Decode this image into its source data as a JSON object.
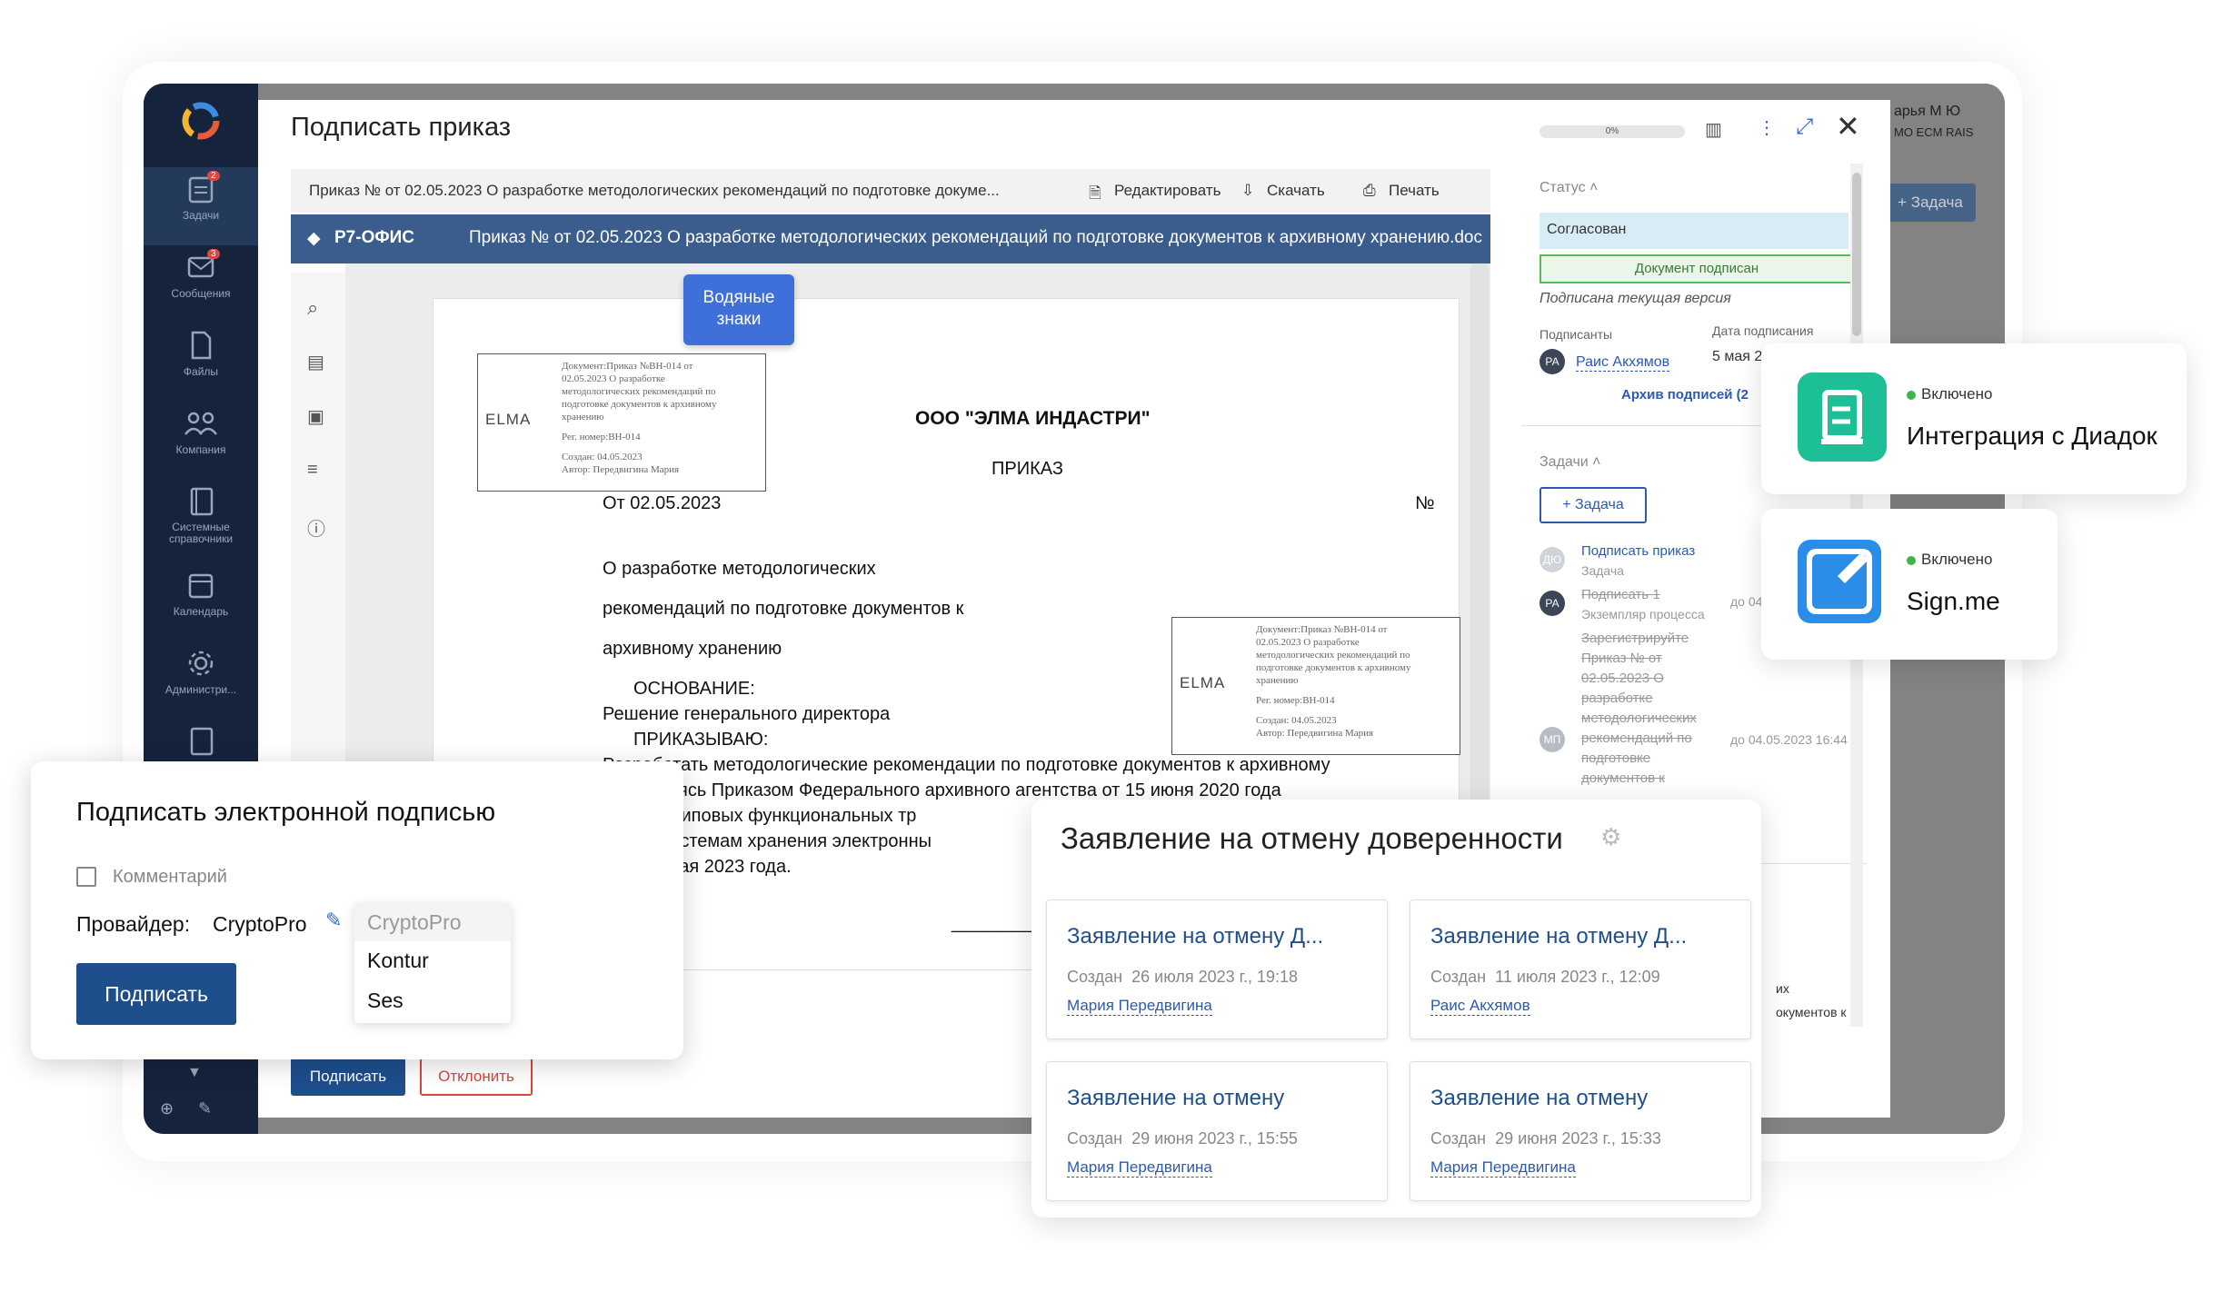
{
  "sidebar": {
    "items": [
      {
        "label": "Задачи",
        "badge": "2"
      },
      {
        "label": "Сообщения",
        "badge": "3"
      },
      {
        "label": "Файлы"
      },
      {
        "label": "Компания"
      },
      {
        "label": "Системные справочники"
      },
      {
        "label": "Календарь"
      },
      {
        "label": "Администри..."
      }
    ]
  },
  "topbar": {
    "user": "арья М Ю",
    "org": "МО ECM RAIS",
    "task_button": "+ Задача"
  },
  "modal": {
    "title": "Подписать приказ",
    "progress_label": "0%",
    "document_title": "Приказ № от 02.05.2023 О разработке методологических рекомендаций по подготовке докуме...",
    "actions": {
      "edit": "Редактировать",
      "download": "Скачать",
      "print": "Печать"
    },
    "editor_name": "Р7-ОФИС",
    "editor_doc_title": "Приказ № от 02.05.2023 О разработке методологических рекомендаций по подготовке документов к архивному хранению.doc",
    "watermark_tooltip": [
      "Водяные",
      "знаки"
    ],
    "sign_button": "Подписать",
    "reject_button": "Отклонить"
  },
  "document": {
    "company": "ООО \"ЭЛМА ИНДАСТРИ\"",
    "doc_type": "ПРИКАЗ",
    "date_line": "От 02.05.2023",
    "number_sign": "№",
    "subject": [
      "О разработке методологических",
      "рекомендаций по подготовке документов к",
      "архивному хранению"
    ],
    "basis_heading": "ОСНОВАНИЕ:",
    "basis_text": "Решение генерального директора",
    "order_heading": "ПРИКАЗЫВАЮ:",
    "body_lines": [
      "Разработать методологические рекомендации по подготовке документов к архивному",
      "оводствуясь Приказом Федерального архивного агентства от 15 июня 2020 года",
      "ждении Типовых функциональных тр",
      "рота и системам хранения электронны",
      "к до 31 мая 2023 года."
    ],
    "signature_line": "_________________",
    "stamp": {
      "logo": "ELMA",
      "lines": [
        "Документ:Приказ №ВН-014 от",
        "02.05.2023 О разработке",
        "методологических рекомендаций по",
        "подготовке документов к архивному",
        "хранению"
      ],
      "reg": "Рег. номер:ВН-014",
      "created": "Создан: 04.05.2023",
      "author": "Автор: Передвигина Мария"
    }
  },
  "right_panel": {
    "status_label": "Статус",
    "status_value": "Согласован",
    "signed_badge": "Документ подписан",
    "signed_note": "Подписана текущая версия",
    "signers_label": "Подписанты",
    "sign_date_label": "Дата подписания",
    "signer_initials": "РА",
    "signer_name": "Раис Акхямов",
    "sign_date": "5 мая 2",
    "archive_link": "Архив подписей (2",
    "tasks_label": "Задачи",
    "add_task": "+ Задача",
    "tasks": [
      {
        "initials": "ДЮ",
        "title": "Подписать приказ",
        "sub": "Задача",
        "due": ""
      },
      {
        "initials": "РА",
        "title": "Подписать 1",
        "sub": "Экземпляр процесса",
        "due": "до 04"
      },
      {
        "initials": "",
        "title": "Зарегистрируйте Приказ № от 02.05.2023 О разработке методологических рекомендаций по подготовке документов к",
        "sub": "",
        "due": ""
      },
      {
        "initials": "МП",
        "title": "",
        "sub": "",
        "due": "до 04.05.2023 16:44"
      }
    ],
    "bottom_fragment": [
      "их",
      "окументов к"
    ]
  },
  "sign_dialog": {
    "title": "Подписать электронной подписью",
    "comment_label": "Комментарий",
    "provider_label": "Провайдер:",
    "provider_value": "CryptoPro",
    "options": [
      "CryptoPro",
      "Kontur",
      "Ses"
    ],
    "sign_button": "Подписать"
  },
  "integrations": [
    {
      "status": "Включено",
      "name": "Интеграция с Диадок",
      "color": "#1dbf97"
    },
    {
      "status": "Включено",
      "name": "Sign.me",
      "color": "#2a8de8"
    }
  ],
  "claims": {
    "title": "Заявление на отмену доверенности",
    "created_label": "Создан",
    "cards": [
      {
        "title": "Заявление на отмену Д...",
        "date": "26 июля 2023 г., 19:18",
        "author": "Мария Передвигина"
      },
      {
        "title": "Заявление на отмену Д...",
        "date": "11 июля 2023 г., 12:09",
        "author": "Раис Акхямов"
      },
      {
        "title": "Заявление на отмену",
        "date": "29 июня 2023 г., 15:55",
        "author": "Мария Передвигина"
      },
      {
        "title": "Заявление на отмену",
        "date": "29 июня 2023 г., 15:33",
        "author": "Мария Передвигина"
      }
    ]
  },
  "colors": {
    "sidebar": "#15233c",
    "primary": "#1e4e8c",
    "link": "#2b5ab0",
    "editor_bar": "#3a5d8e",
    "reject": "#d9463a",
    "enabled": "#3cb54a"
  }
}
